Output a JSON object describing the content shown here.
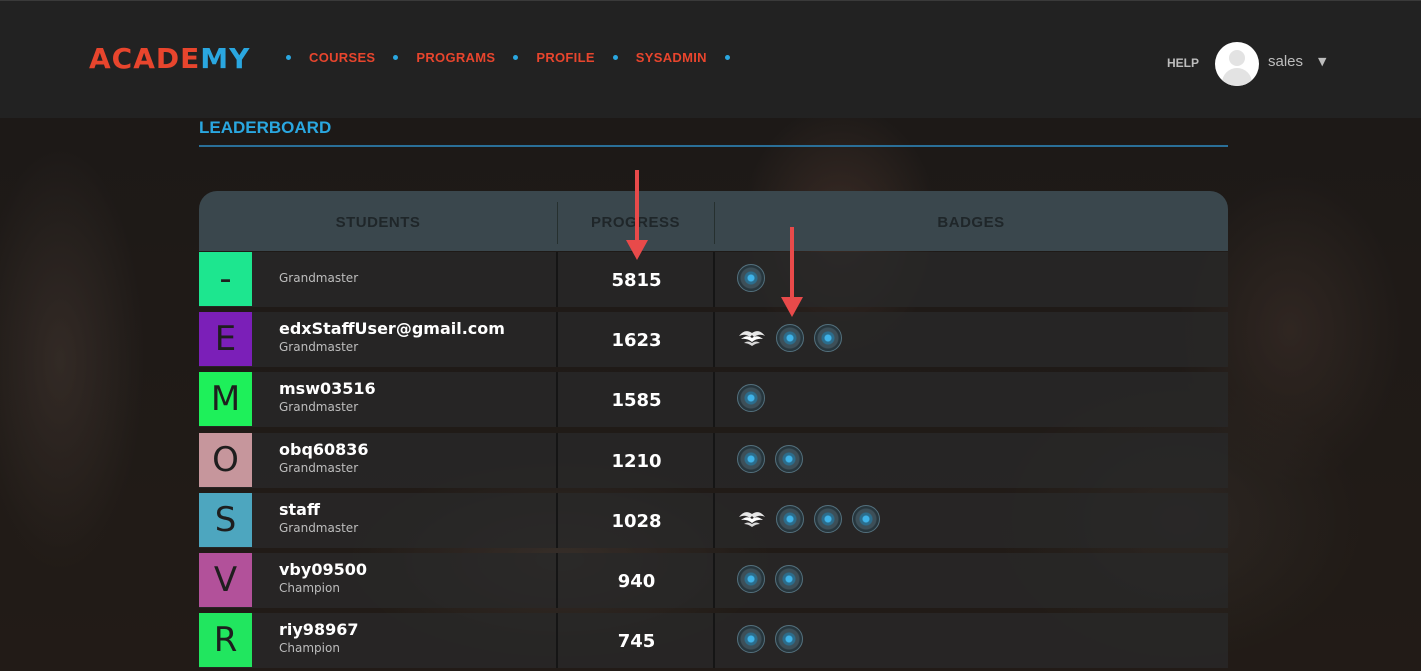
{
  "app": {
    "logo": {
      "main": "ACADE",
      "accent": "MY"
    },
    "nav": [
      "COURSES",
      "PROGRAMS",
      "PROFILE",
      "SYSADMIN"
    ],
    "help": "HELP",
    "username": "sales",
    "caret": "▼"
  },
  "leaderboard": {
    "title": "LEADERBOARD",
    "headers": {
      "students": "STUDENTS",
      "progress": "PROGRESS",
      "badges": "BADGES"
    },
    "rows": [
      {
        "initial": "-",
        "color": "#1de68f",
        "name": "",
        "level": "Grandmaster",
        "score": "5815",
        "badges": [
          "circle"
        ]
      },
      {
        "initial": "E",
        "color": "#7b1fb8",
        "name": "edxStaffUser@gmail.com",
        "level": "Grandmaster",
        "score": "1623",
        "badges": [
          "wing",
          "circle",
          "circle"
        ]
      },
      {
        "initial": "M",
        "color": "#1ef05a",
        "name": "msw03516",
        "level": "Grandmaster",
        "score": "1585",
        "badges": [
          "circle"
        ]
      },
      {
        "initial": "O",
        "color": "#c6969c",
        "name": "obq60836",
        "level": "Grandmaster",
        "score": "1210",
        "badges": [
          "circle",
          "circle"
        ]
      },
      {
        "initial": "S",
        "color": "#4da6bf",
        "name": "staff",
        "level": "Grandmaster",
        "score": "1028",
        "badges": [
          "wing",
          "circle",
          "circle",
          "circle"
        ]
      },
      {
        "initial": "V",
        "color": "#b2519a",
        "name": "vby09500",
        "level": "Champion",
        "score": "940",
        "badges": [
          "circle",
          "circle"
        ]
      },
      {
        "initial": "R",
        "color": "#21e65f",
        "name": "riy98967",
        "level": "Champion",
        "score": "745",
        "badges": [
          "circle",
          "circle"
        ]
      }
    ]
  },
  "colors": {
    "brand_red": "#e8452d",
    "brand_blue": "#2aa7e0",
    "arrow": "#e84a4a"
  }
}
